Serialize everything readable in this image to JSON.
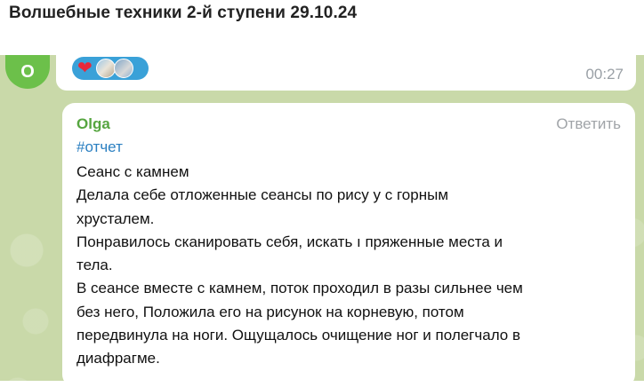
{
  "header": {
    "title": "Волшебные техники 2-й ступени 29.10.24"
  },
  "prev_message": {
    "avatar_letter": "О",
    "time": "00:27",
    "reactions": [
      "heart-reaction",
      "user-avatar",
      "user-avatar"
    ]
  },
  "message": {
    "sender": "Olga",
    "reply_label": "Ответить",
    "hashtag": "#отчет",
    "lines": [
      "Сеанс с камнем",
      "Делала себе отложенные сеансы по рису  у с горным",
      "хрусталем.",
      "Понравилось сканировать себя, искать ı  пряженные места и",
      "тела.",
      "В сеансе вместе с камнем, поток проходил в разы сильнее чем",
      "без него, Положила его на рисунок на корневую, потом",
      "передвинула на ноги. Ощущалось очищение ног и полегчало в",
      "диафрагме."
    ]
  },
  "colors": {
    "chat_background": "#c9d9a9",
    "accent_green": "#56a540",
    "avatar_green": "#6cc04a",
    "hashtag_blue": "#2a7fc1",
    "reaction_blue": "#3aa1d8"
  }
}
